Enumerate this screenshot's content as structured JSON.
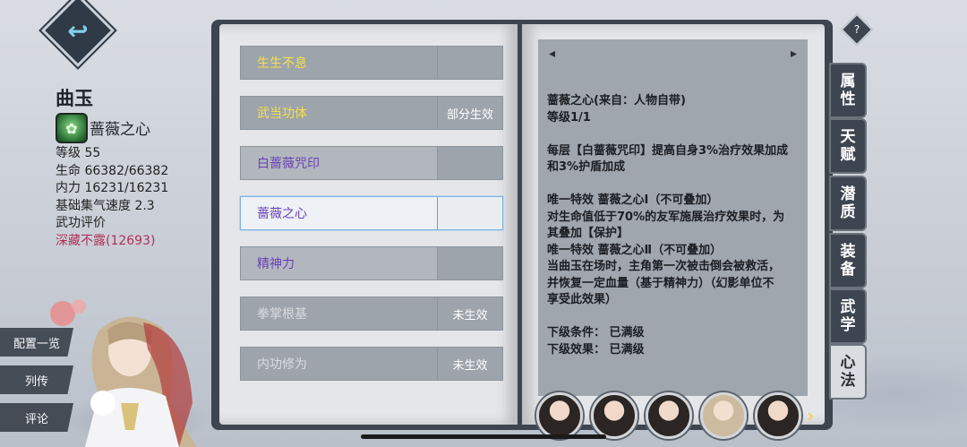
{
  "character": {
    "name": "曲玉",
    "core_skill": "蔷薇之心",
    "core_skill_icon": "rose-heart-icon",
    "stats": [
      "等级 55",
      "生命 66382/66382",
      "内力 16231/16231",
      "基础集气速度 2.3",
      "武功评价"
    ],
    "rating": "深藏不露(12693)"
  },
  "left_menu": [
    "配置一览",
    "列传",
    "评论"
  ],
  "skills": [
    {
      "name": "生生不息",
      "state": "",
      "style": "gold"
    },
    {
      "name": "武当功体",
      "state": "部分生效",
      "style": "gold"
    },
    {
      "name": "白蔷薇咒印",
      "state": "",
      "style": "purple"
    },
    {
      "name": "蔷薇之心",
      "state": "",
      "style": "sel"
    },
    {
      "name": "精神力",
      "state": "",
      "style": "purple"
    },
    {
      "name": "拳掌根基",
      "state": "未生效",
      "style": "grey"
    },
    {
      "name": "内功修为",
      "state": "未生效",
      "style": "grey"
    }
  ],
  "nav": {
    "prev": "◂",
    "next": "▸"
  },
  "description": {
    "line1": "蔷薇之心(来自：人物自带)",
    "line2": "等级1/1",
    "line3": "每层【白蔷薇咒印】提高自身3%治疗效果加成",
    "line4": "和3%护盾加成",
    "line5": "唯一特效 蔷薇之心Ⅰ（不可叠加）",
    "line6": "对生命值低于70%的友军施展治疗效果时，为",
    "line7": "其叠加【保护】",
    "line8": "唯一特效 蔷薇之心Ⅱ（不可叠加）",
    "line9": "当曲玉在场时，主角第一次被击倒会被救活，",
    "line10": "并恢复一定血量（基于精神力）（幻影单位不",
    "line11": "享受此效果）",
    "line12": "下级条件： 已满级",
    "line13": "下级效果： 已满级"
  },
  "tabs": [
    "属性",
    "天赋",
    "潜质",
    "装备",
    "武学",
    "心法"
  ],
  "active_tab": "心法",
  "help_label": "?",
  "colors": {
    "gold": "#f4e04a",
    "purple": "#6b3fb8",
    "rating": "#b2305a"
  }
}
